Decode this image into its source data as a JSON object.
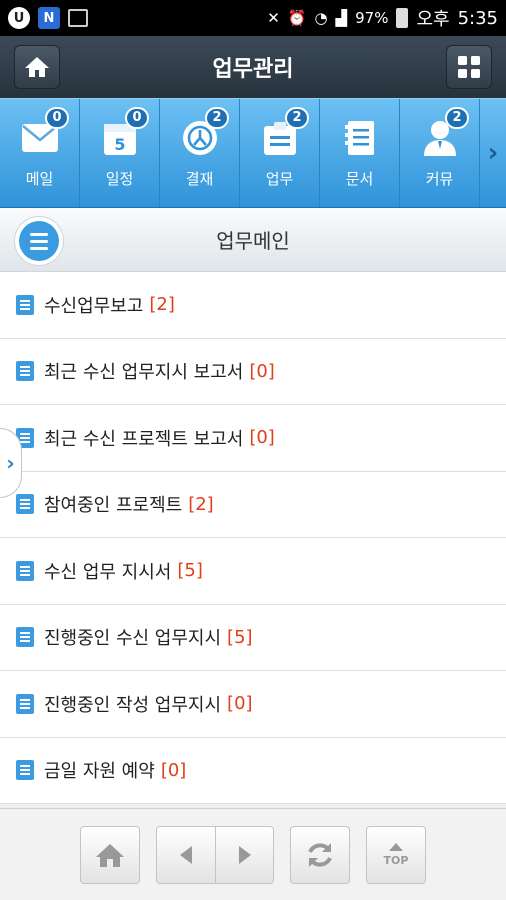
{
  "status_bar": {
    "battery": "97%",
    "ampm": "오후",
    "time": "5:35"
  },
  "header": {
    "title": "업무관리"
  },
  "menu": [
    {
      "label": "메일",
      "badge": "0",
      "icon": "mail-icon"
    },
    {
      "label": "일정",
      "badge": "0",
      "icon": "calendar-icon"
    },
    {
      "label": "결재",
      "badge": "2",
      "icon": "approval-icon"
    },
    {
      "label": "업무",
      "badge": "2",
      "icon": "task-icon"
    },
    {
      "label": "문서",
      "badge": "",
      "icon": "document-icon"
    },
    {
      "label": "커뮤",
      "badge": "2",
      "icon": "community-icon"
    }
  ],
  "calendar_day": "5",
  "section": {
    "title": "업무메인"
  },
  "list": [
    {
      "text": "수신업무보고",
      "count": "[2]"
    },
    {
      "text": "최근 수신 업무지시 보고서",
      "count": "[0]"
    },
    {
      "text": "최근 수신 프로젝트 보고서",
      "count": "[0]"
    },
    {
      "text": "참여중인 프로젝트",
      "count": "[2]"
    },
    {
      "text": "수신 업무 지시서",
      "count": "[5]"
    },
    {
      "text": "진행중인 수신 업무지시",
      "count": "[5]"
    },
    {
      "text": "진행중인 작성 업무지시",
      "count": "[0]"
    },
    {
      "text": "금일 자원 예약",
      "count": "[0]"
    }
  ],
  "bottom": {
    "top_label": "TOP"
  },
  "colors": {
    "accent": "#3a9be0",
    "count": "#e0401a",
    "header": "#2f3b47"
  }
}
